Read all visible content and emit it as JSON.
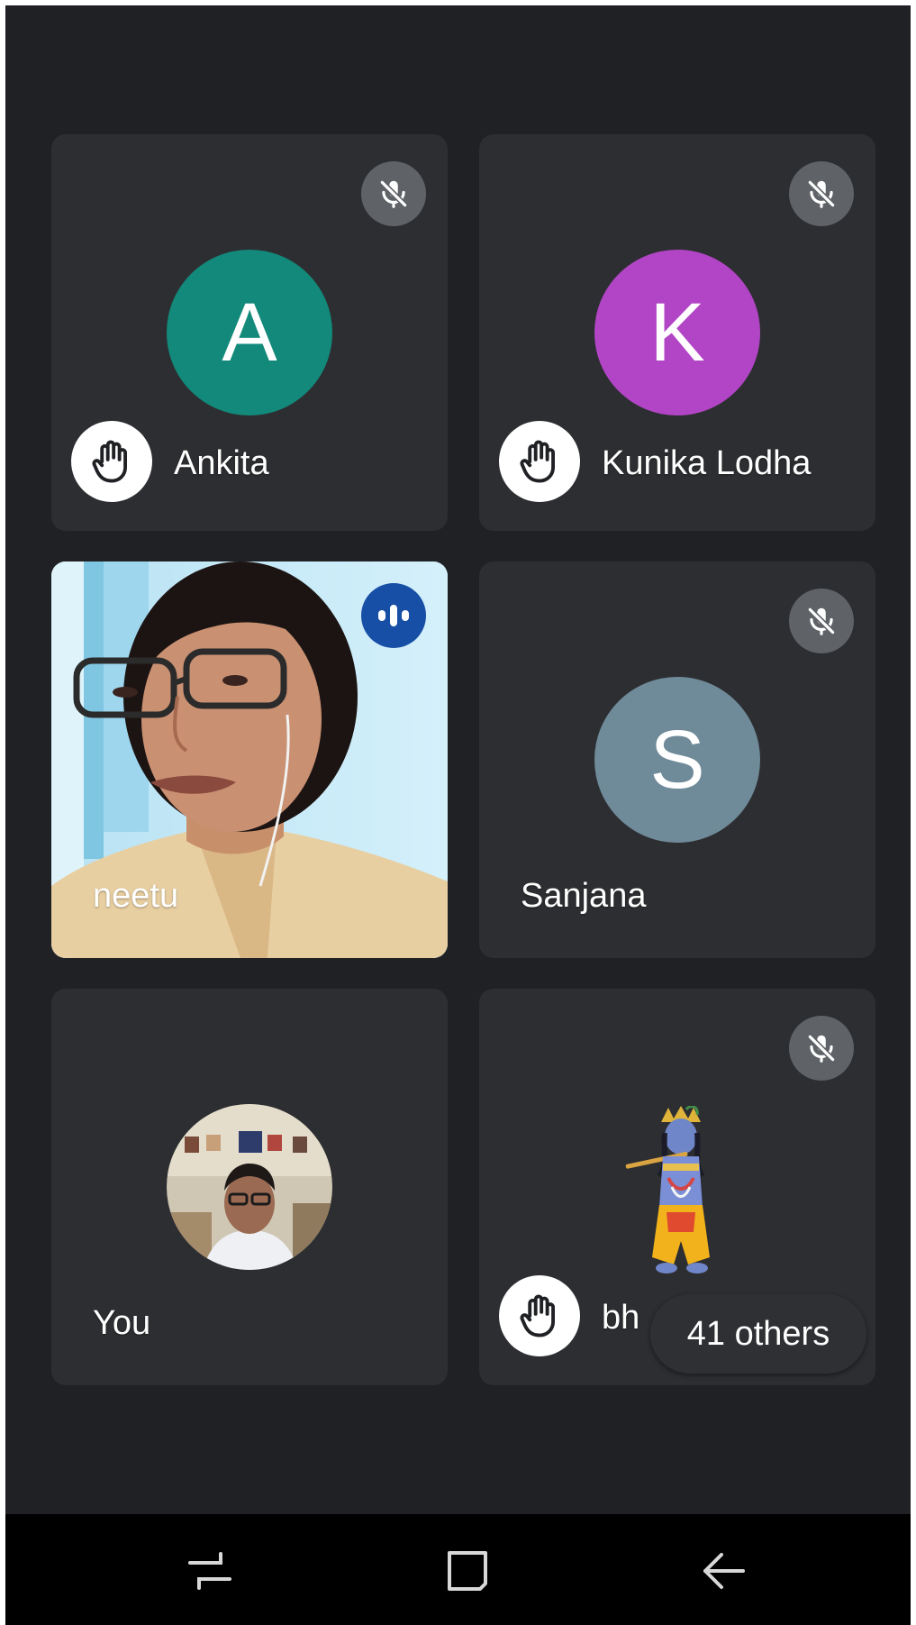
{
  "colors": {
    "background": "#202124",
    "tile": "#2d2e31",
    "mute_badge": "#5f6368",
    "speaking_badge": "#174ea6",
    "avatar_ankita": "#12897a",
    "avatar_kunika": "#b245c6",
    "avatar_sanjana": "#6f8a99"
  },
  "participants": [
    {
      "name": "Ankita",
      "initial": "A",
      "muted": true,
      "hand_raised": true,
      "icons": [
        "mic-off-icon",
        "raised-hand-icon"
      ]
    },
    {
      "name": "Kunika Lodha",
      "initial": "K",
      "muted": true,
      "hand_raised": true,
      "icons": [
        "mic-off-icon",
        "raised-hand-icon"
      ]
    },
    {
      "name": "neetu",
      "video": true,
      "speaking": true,
      "icons": [
        "audio-level-icon"
      ]
    },
    {
      "name": "Sanjana",
      "initial": "S",
      "muted": true,
      "icons": [
        "mic-off-icon"
      ]
    },
    {
      "name": "You",
      "profile_photo": true
    },
    {
      "name": "bhavna",
      "visible_name": "bh",
      "muted": true,
      "hand_raised": true,
      "profile_picture": "krishna-figure",
      "icons": [
        "mic-off-icon",
        "raised-hand-icon"
      ]
    }
  ],
  "others_label": "41 others",
  "navbar": {
    "buttons": [
      "recents-icon",
      "home-icon",
      "back-icon"
    ]
  }
}
